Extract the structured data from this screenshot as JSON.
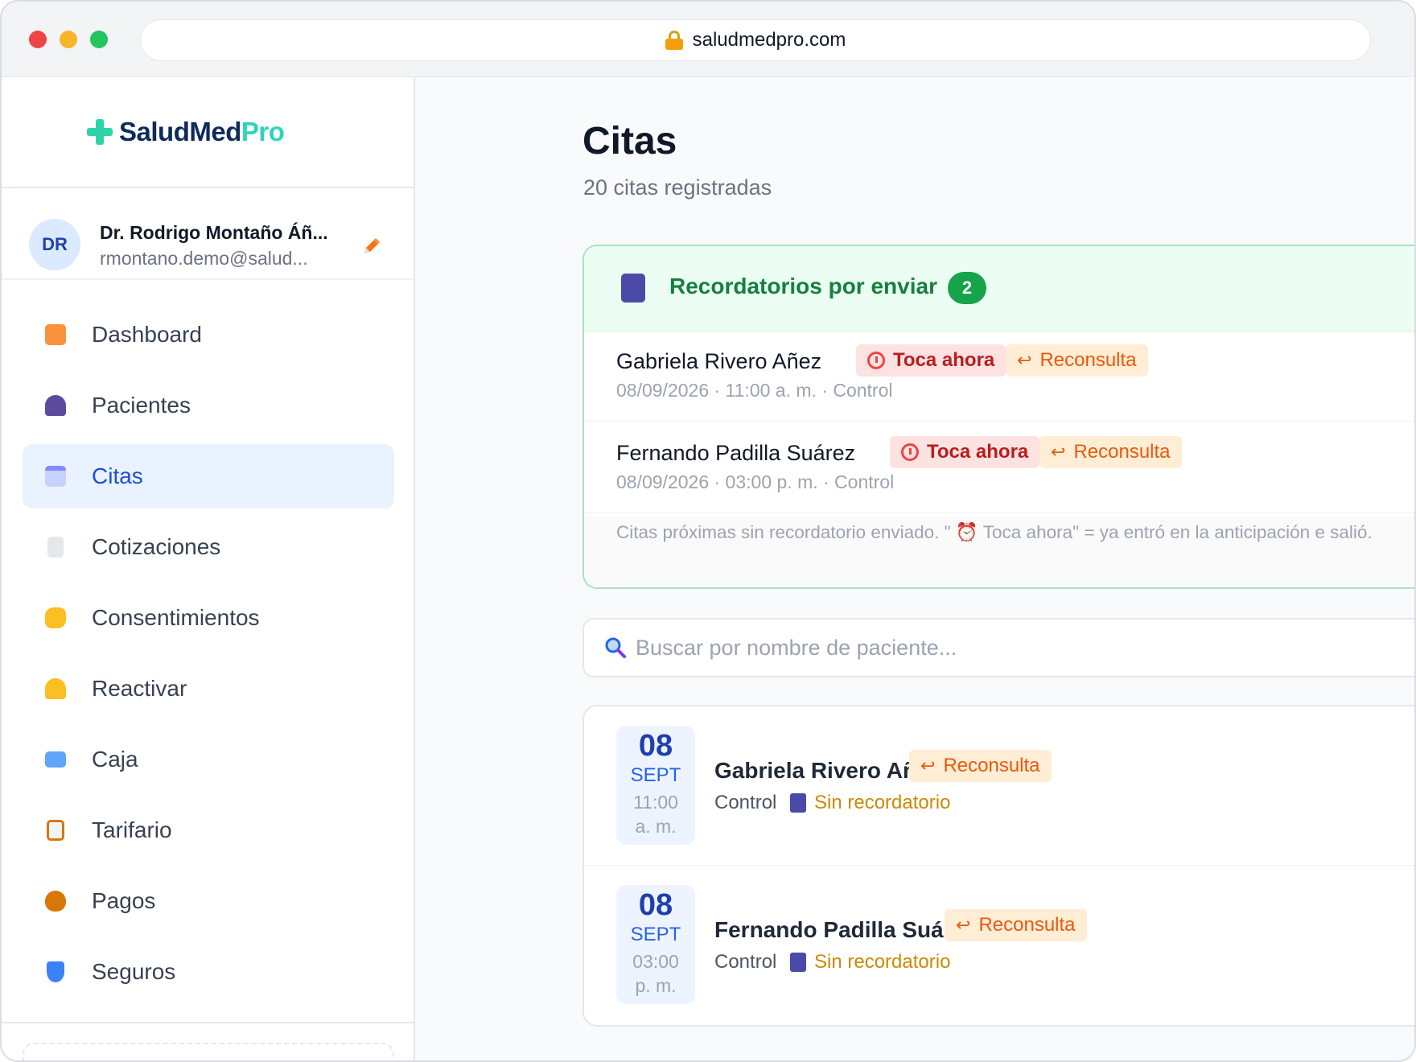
{
  "browser": {
    "url": "saludmedpro.com"
  },
  "brand": {
    "part1": "SaludMed",
    "part2": "Pro"
  },
  "user": {
    "initials": "DR",
    "name": "Dr. Rodrigo Montaño Áñ...",
    "email": "rmontano.demo@salud..."
  },
  "nav": [
    {
      "label": "Dashboard",
      "icon": "house-icon",
      "active": false
    },
    {
      "label": "Pacientes",
      "icon": "people-icon",
      "active": false
    },
    {
      "label": "Citas",
      "icon": "calendar-icon",
      "active": true
    },
    {
      "label": "Cotizaciones",
      "icon": "receipt-icon",
      "active": false
    },
    {
      "label": "Consentimientos",
      "icon": "writing-hand-icon",
      "active": false
    },
    {
      "label": "Reactivar",
      "icon": "bell-icon",
      "active": false
    },
    {
      "label": "Caja",
      "icon": "atm-icon",
      "active": false
    },
    {
      "label": "Tarifario",
      "icon": "clipboard-icon",
      "active": false
    },
    {
      "label": "Pagos",
      "icon": "money-bag-icon",
      "active": false
    },
    {
      "label": "Seguros",
      "icon": "shield-icon",
      "active": false
    }
  ],
  "page": {
    "title": "Citas",
    "subtitle": "20 citas registradas"
  },
  "reminders": {
    "title": "Recordatorios por enviar",
    "count": "2",
    "rows": [
      {
        "name": "Gabriela Rivero Añez",
        "now_badge": "Toca ahora",
        "type_badge": "Reconsulta",
        "meta": "08/09/2026 · 11:00 a. m. · Control"
      },
      {
        "name": "Fernando Padilla Suárez",
        "now_badge": "Toca ahora",
        "type_badge": "Reconsulta",
        "meta": "08/09/2026 · 03:00 p. m. · Control"
      }
    ],
    "note": "Citas próximas sin recordatorio enviado. \" ⏰ Toca ahora\" = ya entró en la anticipación e salió."
  },
  "search": {
    "placeholder": "Buscar por nombre de paciente..."
  },
  "appointments": [
    {
      "day": "08",
      "month": "SEPT",
      "time": "11:00",
      "ampm": "a. m.",
      "name": "Gabriela Rivero Añez",
      "badge": "Reconsulta",
      "type": "Control",
      "reminder": "Sin recordatorio"
    },
    {
      "day": "08",
      "month": "SEPT",
      "time": "03:00",
      "ampm": "p. m.",
      "name": "Fernando Padilla Suárez",
      "badge": "Reconsulta",
      "type": "Control",
      "reminder": "Sin recordatorio"
    }
  ],
  "colors": {
    "accent": "#1d4ed8",
    "brand_teal": "#2dd4bf",
    "success": "#16a34a",
    "danger": "#b91c1c",
    "warning": "#ea580c"
  }
}
